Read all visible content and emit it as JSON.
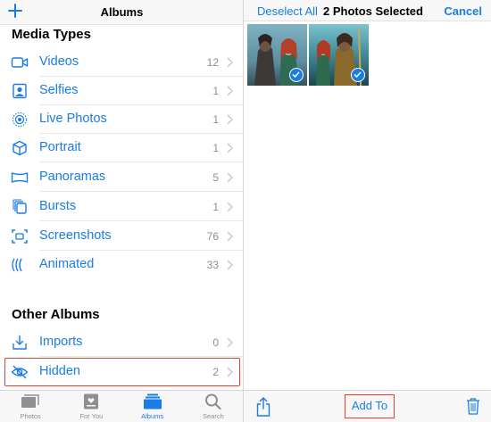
{
  "left_header": {
    "title": "Albums",
    "add_icon": "plus-icon"
  },
  "media_types": {
    "title": "Media Types",
    "items": [
      {
        "label": "Videos",
        "count": "12",
        "icon": "video-camera-icon"
      },
      {
        "label": "Selfies",
        "count": "1",
        "icon": "selfie-portrait-icon"
      },
      {
        "label": "Live Photos",
        "count": "1",
        "icon": "live-photo-icon"
      },
      {
        "label": "Portrait",
        "count": "1",
        "icon": "cube-icon"
      },
      {
        "label": "Panoramas",
        "count": "5",
        "icon": "panorama-icon"
      },
      {
        "label": "Bursts",
        "count": "1",
        "icon": "burst-icon"
      },
      {
        "label": "Screenshots",
        "count": "76",
        "icon": "screenshot-icon"
      },
      {
        "label": "Animated",
        "count": "33",
        "icon": "animated-icon"
      }
    ]
  },
  "other_albums": {
    "title": "Other Albums",
    "items": [
      {
        "label": "Imports",
        "count": "0",
        "icon": "import-icon"
      },
      {
        "label": "Hidden",
        "count": "2",
        "icon": "eye-slash-icon"
      }
    ]
  },
  "tabbar": {
    "tabs": [
      {
        "label": "Photos",
        "icon": "photos-icon",
        "active": false
      },
      {
        "label": "For You",
        "icon": "for-you-icon",
        "active": false
      },
      {
        "label": "Albums",
        "icon": "albums-icon",
        "active": true
      },
      {
        "label": "Search",
        "icon": "search-icon",
        "active": false
      }
    ]
  },
  "right_header": {
    "deselect_label": "Deselect All",
    "title": "2 Photos Selected",
    "cancel_label": "Cancel"
  },
  "photos": [
    {
      "name": "photo-1",
      "selected": true
    },
    {
      "name": "photo-2",
      "selected": true
    }
  ],
  "right_toolbar": {
    "share_icon": "share-icon",
    "add_to_label": "Add To",
    "trash_icon": "trash-icon"
  },
  "colors": {
    "accent": "#1a7ce6",
    "highlight": "#e0442c",
    "count_gray": "#8e8e93"
  }
}
